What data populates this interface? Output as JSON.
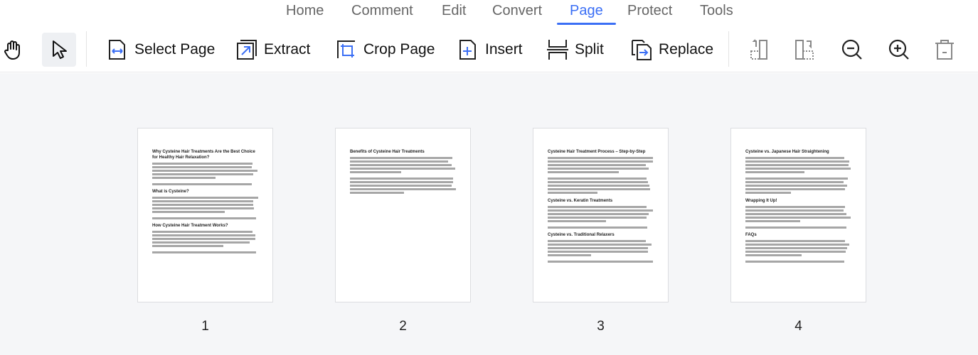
{
  "tabs": [
    {
      "label": "Home"
    },
    {
      "label": "Comment"
    },
    {
      "label": "Edit"
    },
    {
      "label": "Convert"
    },
    {
      "label": "Page",
      "active": true
    },
    {
      "label": "Protect"
    },
    {
      "label": "Tools"
    }
  ],
  "toolbar": {
    "select_page": "Select Page",
    "extract": "Extract",
    "crop_page": "Crop Page",
    "insert": "Insert",
    "split": "Split",
    "replace": "Replace"
  },
  "accent": "#3b6ff5",
  "pages": [
    {
      "number": "1",
      "headings": [
        "Why Cysteine Hair Treatments Are the Best Choice for Healthy Hair Relaxation?",
        "What is Cysteine?",
        "How Cysteine Hair Treatment Works?"
      ]
    },
    {
      "number": "2",
      "headings": [
        "Benefits of Cysteine Hair Treatments"
      ]
    },
    {
      "number": "3",
      "headings": [
        "Cysteine Hair Treatment Process – Step-by-Step",
        "Cysteine vs. Keratin Treatments",
        "Cysteine vs. Traditional Relaxers"
      ]
    },
    {
      "number": "4",
      "headings": [
        "Cysteine vs. Japanese Hair Straightening",
        "Wrapping It Up!",
        "FAQs"
      ]
    }
  ]
}
